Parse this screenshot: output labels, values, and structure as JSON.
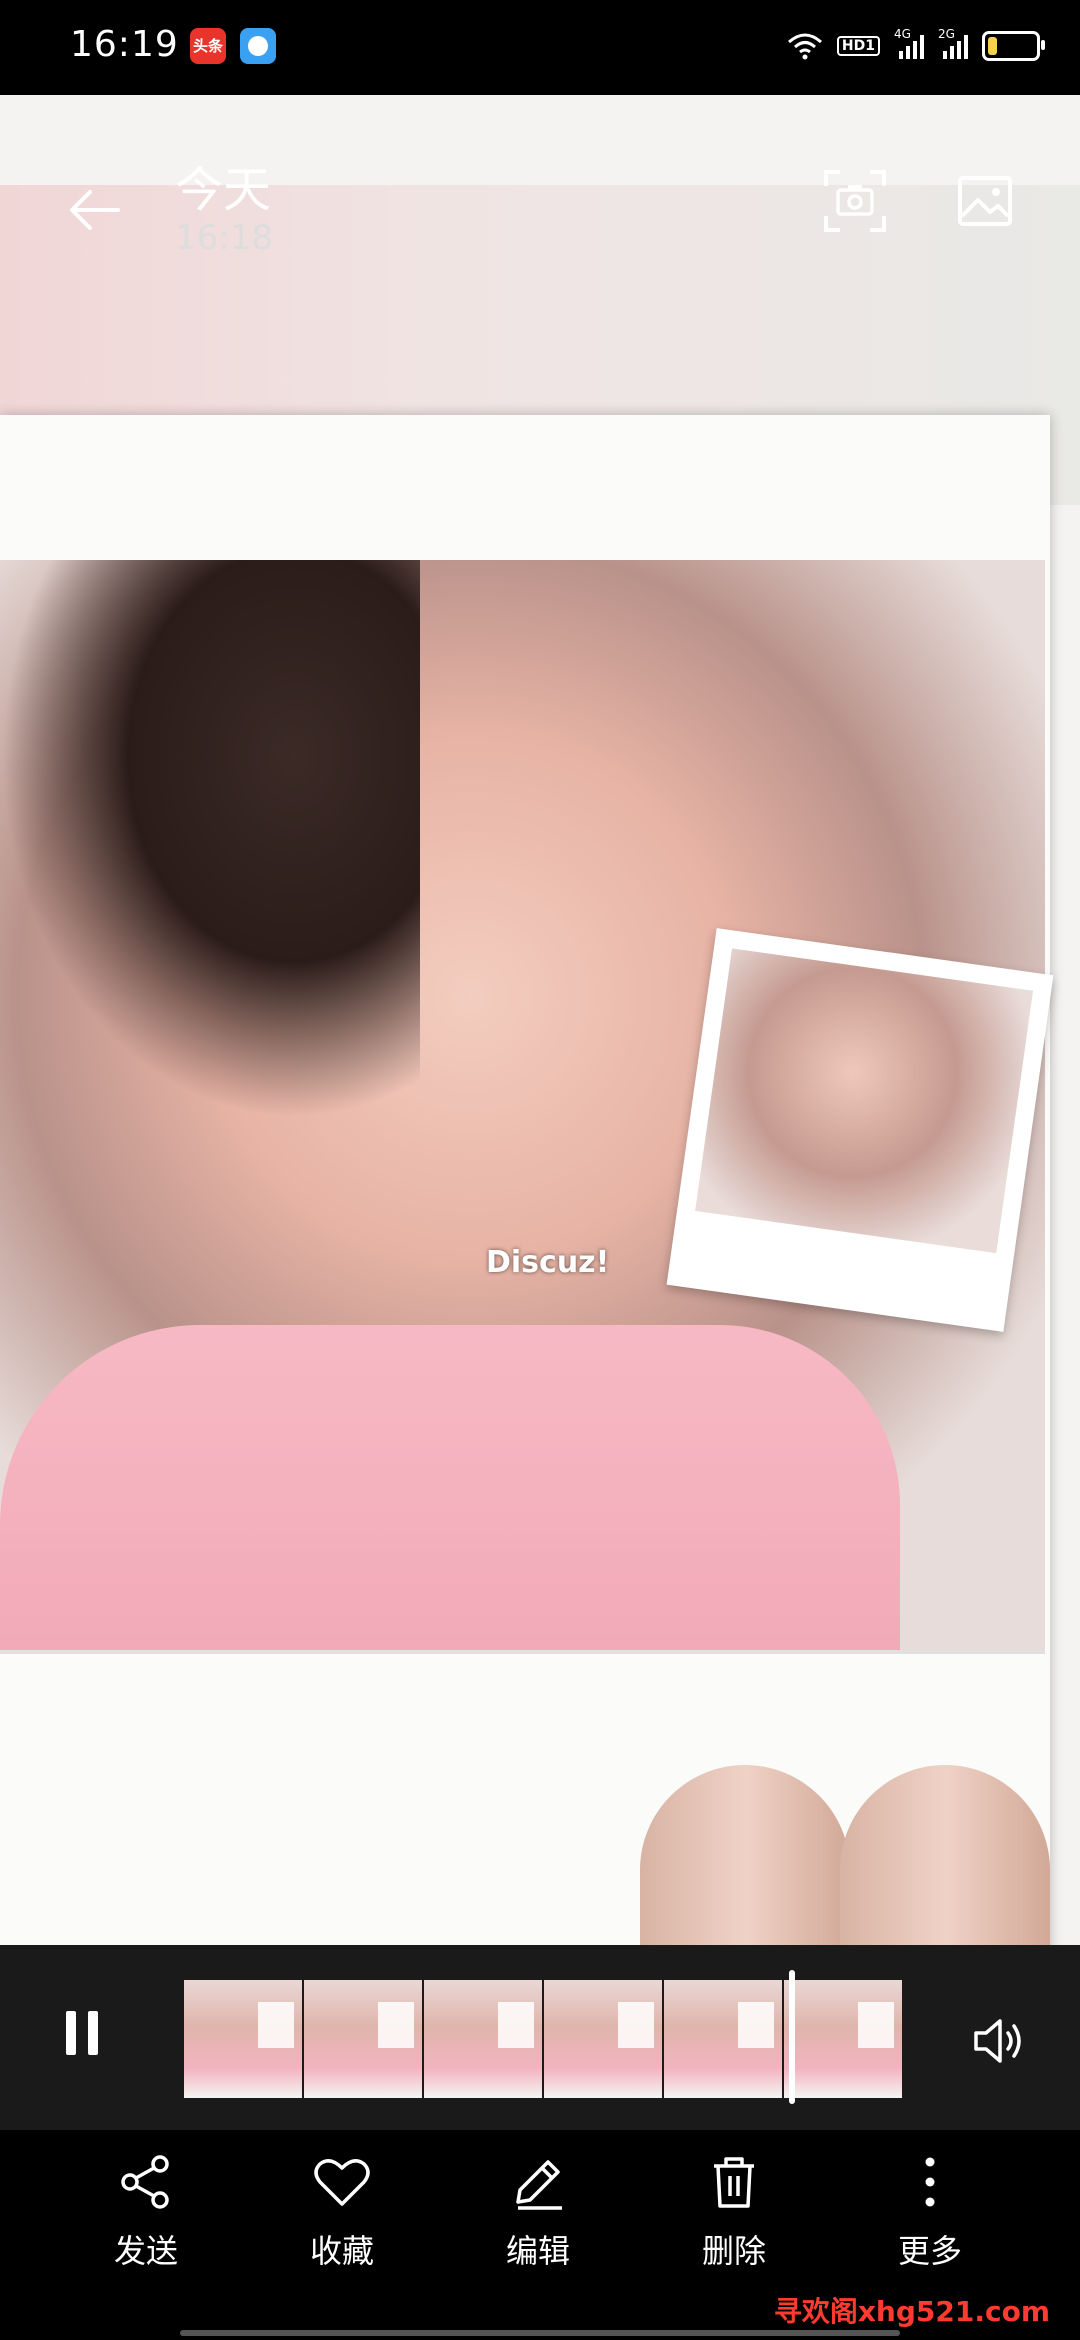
{
  "status_bar": {
    "time": "16:19",
    "badge_toutiao": "头条",
    "hd_label": "HD1",
    "sim1": "4G",
    "sim2": "2G",
    "battery_level": 0.2,
    "battery_color": "#f5d24a"
  },
  "header": {
    "title": "今天",
    "subtitle": "16:18",
    "icons": [
      "back-arrow-icon",
      "screenshot-icon",
      "gallery-icon"
    ]
  },
  "photo": {
    "overlay_text": "Discuz!"
  },
  "video": {
    "progress": 0.84,
    "icons": [
      "pause-icon",
      "volume-icon"
    ],
    "thumbnail_count": 6
  },
  "actions": [
    {
      "label": "发送",
      "icon": "share-icon"
    },
    {
      "label": "收藏",
      "icon": "heart-icon"
    },
    {
      "label": "编辑",
      "icon": "pencil-icon"
    },
    {
      "label": "删除",
      "icon": "trash-icon"
    },
    {
      "label": "更多",
      "icon": "more-vertical-icon"
    }
  ],
  "watermark": "寻欢阁xhg521.com"
}
